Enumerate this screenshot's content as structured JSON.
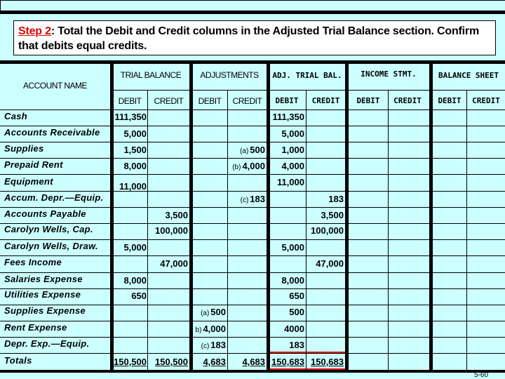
{
  "instruction": {
    "step_label": "Step 2",
    "text": ": Total the Debit and Credit columns in the Adjusted Trial Balance section. Confirm that debits equal credits."
  },
  "headers": {
    "account_name": "ACCOUNT NAME",
    "sections": [
      "TRIAL BALANCE",
      "ADJUSTMENTS",
      "ADJ. TRIAL BAL.",
      "INCOME STMT.",
      "BALANCE SHEET"
    ],
    "debit": "DEBIT",
    "credit": "CREDIT"
  },
  "rows": [
    {
      "account": "Cash",
      "tb_debit": "111,350",
      "tb_credit": "",
      "adj_debit": "",
      "adj_credit": "",
      "atb_debit": "111,350",
      "atb_credit": ""
    },
    {
      "account": "Accounts Receivable",
      "tb_debit": "5,000",
      "tb_credit": "",
      "adj_debit": "",
      "adj_credit": "",
      "atb_debit": "5,000",
      "atb_credit": ""
    },
    {
      "account": "Supplies",
      "tb_debit": "1,500",
      "tb_credit": "",
      "adj_debit": "",
      "adj_credit": {
        "tag": "(a)",
        "value": "500"
      },
      "atb_debit": "1,000",
      "atb_credit": ""
    },
    {
      "account": "Prepaid Rent",
      "tb_debit": "8,000",
      "tb_credit": "",
      "adj_debit": "",
      "adj_credit": {
        "tag": "(b)",
        "value": "4,000"
      },
      "atb_debit": "4,000",
      "atb_credit": ""
    },
    {
      "account": "Equipment",
      "tb_debit": "11,000",
      "tb_credit": "",
      "adj_debit": "",
      "adj_credit": "",
      "atb_debit": "11,000",
      "atb_credit": ""
    },
    {
      "account": "Accum. Depr.—Equip.",
      "tb_debit": "",
      "tb_credit": "",
      "adj_debit": "",
      "adj_credit": {
        "tag": "(c)",
        "value": "183"
      },
      "atb_debit": "",
      "atb_credit": "183"
    },
    {
      "account": "Accounts Payable",
      "tb_debit": "",
      "tb_credit": "3,500",
      "adj_debit": "",
      "adj_credit": "",
      "atb_debit": "",
      "atb_credit": "3,500"
    },
    {
      "account": "Carolyn Wells, Cap.",
      "tb_debit": "",
      "tb_credit": "100,000",
      "adj_debit": "",
      "adj_credit": "",
      "atb_debit": "",
      "atb_credit": "100,000"
    },
    {
      "account": "Carolyn Wells, Draw.",
      "tb_debit": "5,000",
      "tb_credit": "",
      "adj_debit": "",
      "adj_credit": "",
      "atb_debit": "5,000",
      "atb_credit": ""
    },
    {
      "account": "Fees Income",
      "tb_debit": "",
      "tb_credit": "47,000",
      "adj_debit": "",
      "adj_credit": "",
      "atb_debit": "",
      "atb_credit": "47,000"
    },
    {
      "account": "Salaries Expense",
      "tb_debit": "8,000",
      "tb_credit": "",
      "adj_debit": "",
      "adj_credit": "",
      "atb_debit": "8,000",
      "atb_credit": ""
    },
    {
      "account": "Utilities Expense",
      "tb_debit": "650",
      "tb_credit": "",
      "adj_debit": "",
      "adj_credit": "",
      "atb_debit": "650",
      "atb_credit": ""
    },
    {
      "account": "Supplies Expense",
      "tb_debit": "",
      "tb_credit": "",
      "adj_debit": {
        "tag": "(a)",
        "value": "500"
      },
      "adj_credit": "",
      "atb_debit": "500",
      "atb_credit": ""
    },
    {
      "account": "Rent Expense",
      "tb_debit": "",
      "tb_credit": "",
      "adj_debit": {
        "tag": "b)",
        "value": "4,000"
      },
      "adj_credit": "",
      "atb_debit": "4000",
      "atb_credit": ""
    },
    {
      "account": "Depr. Exp.—Equip.",
      "tb_debit": "",
      "tb_credit": "",
      "adj_debit": {
        "tag": "(c)",
        "value": "183"
      },
      "adj_credit": "",
      "atb_debit": "183",
      "atb_credit": ""
    }
  ],
  "totals": {
    "label": "Totals",
    "tb_debit": "150,500",
    "tb_credit": "150,500",
    "adj_debit": "4,683",
    "adj_credit": "4,683",
    "atb_debit": "150,683",
    "atb_credit": "150,683"
  },
  "page_number": "5-60",
  "colors": {
    "background": "#ccffff",
    "highlight": "#e00000",
    "step_label": "#e00000"
  }
}
